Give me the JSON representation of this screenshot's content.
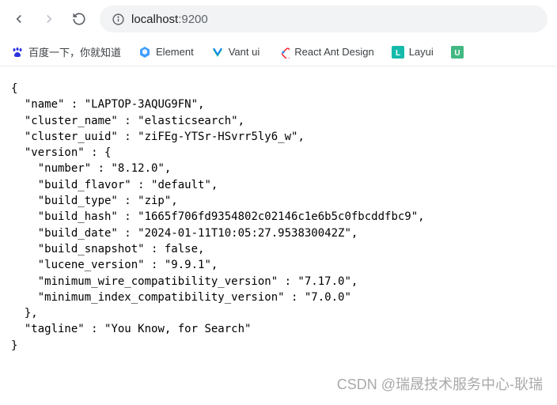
{
  "address": {
    "host": "localhost",
    "port": ":9200"
  },
  "bookmarks": {
    "baidu": "百度一下，你就知道",
    "element": "Element",
    "vant": "Vant ui",
    "react": "React Ant Design",
    "layui": "Layui"
  },
  "json": {
    "name": "LAPTOP-3AQUG9FN",
    "cluster_name": "elasticsearch",
    "cluster_uuid": "ziFEg-YTSr-HSvrr5ly6_w",
    "version": {
      "number": "8.12.0",
      "build_flavor": "default",
      "build_type": "zip",
      "build_hash": "1665f706fd9354802c02146c1e6b5c0fbcddfbc9",
      "build_date": "2024-01-11T10:05:27.953830042Z",
      "build_snapshot": "false",
      "lucene_version": "9.9.1",
      "minimum_wire_compatibility_version": "7.17.0",
      "minimum_index_compatibility_version": "7.0.0"
    },
    "tagline": "You Know, for Search"
  },
  "watermark": "CSDN @瑞晟技术服务中心-耿瑞"
}
